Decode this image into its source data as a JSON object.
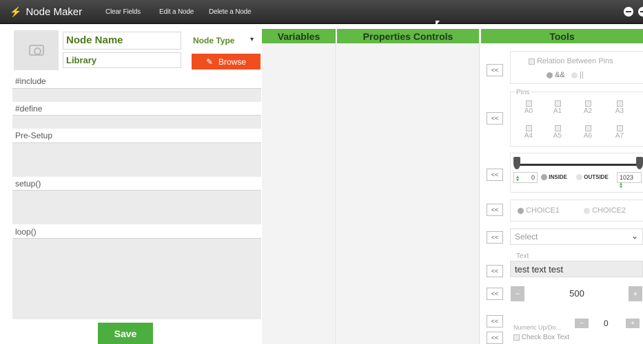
{
  "header": {
    "app_title": "Node Maker",
    "menu": [
      "Clear Fields",
      "Edit a Node",
      "Delete a Node"
    ]
  },
  "form": {
    "node_name": "Node Name",
    "library": "Library",
    "node_type_label": "Node Type",
    "browse_label": "Browse",
    "include_label": "#include",
    "define_label": "#define",
    "presetup_label": "Pre-Setup",
    "setup_label": "setup()",
    "loop_label": "loop()",
    "save_label": "Save"
  },
  "columns": {
    "variables": "Variables",
    "properties": "Properties Controls",
    "tools": "Tools"
  },
  "tools": {
    "collapse_label": "<<",
    "relation": {
      "title": "Relation Between Pins",
      "opt1": "&&",
      "opt2": "||"
    },
    "pins": {
      "title": "Pins",
      "row1": [
        "A0",
        "A1",
        "A2",
        "A3"
      ],
      "row2": [
        "A4",
        "A5",
        "A6",
        "A7"
      ]
    },
    "range": {
      "min_value": "0",
      "inside": "INSIDE",
      "outside": "OUTSIDE",
      "max_value": "1023"
    },
    "choices": {
      "choice1": "CHOICE1",
      "choice2": "CHOICE2"
    },
    "select_placeholder": "Select",
    "text": {
      "legend": "Text",
      "value": "test text test"
    },
    "number_value": "500",
    "numeric": {
      "label": "Numeric Up/Do...",
      "value": "0"
    },
    "checkbox_label": "Check Box Text"
  },
  "colors": {
    "accent_green": "#62b946",
    "browse_orange": "#f04e1e",
    "save_green": "#4cae3e"
  }
}
